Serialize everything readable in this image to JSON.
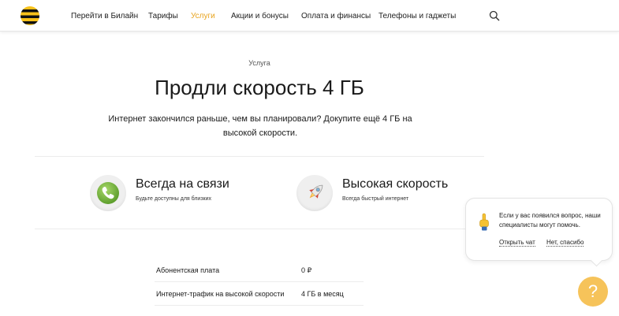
{
  "header": {
    "logo": "beeline-logo",
    "nav": [
      {
        "label": "Перейти в Билайн",
        "active": false
      },
      {
        "label": "Тарифы",
        "active": false
      },
      {
        "label": "Услуги",
        "active": true
      },
      {
        "label": "Акции и бонусы",
        "active": false
      },
      {
        "label": "Оплата и финансы",
        "active": false
      },
      {
        "label": "Телефоны и гаджеты",
        "active": false
      }
    ],
    "search_icon": "search-icon"
  },
  "page": {
    "crumb": "Услуга",
    "title": "Продли скорость 4 ГБ",
    "subtitle_line1": "Интернет закончился раньше, чем вы планировали? Докупите ещё 4 ГБ на",
    "subtitle_line2": "высокой скорости."
  },
  "features": [
    {
      "icon": "phone-icon",
      "title": "Всегда на связи",
      "subtitle": "Будьте доступны для близких"
    },
    {
      "icon": "rocket-icon",
      "title": "Высокая скорость",
      "subtitle": "Всегда быстрый интернет"
    }
  ],
  "specs": [
    {
      "label": "Абонентская плата",
      "value": "0 ₽"
    },
    {
      "label": "Интернет-трафик на высокой скорости",
      "value": "4 ГБ в месяц"
    }
  ],
  "chat": {
    "icon": "pointing-hand-icon",
    "message_line1": "Если у вас появился вопрос, наши",
    "message_line2": "специалисты могут помочь.",
    "open_label": "Открыть чат",
    "dismiss_label": "Нет, спасибо"
  },
  "help": {
    "icon": "question-icon",
    "label": "?"
  },
  "colors": {
    "accent": "#e8a420",
    "brand_yellow": "#f8c11b",
    "help_button": "#f6c35a"
  }
}
